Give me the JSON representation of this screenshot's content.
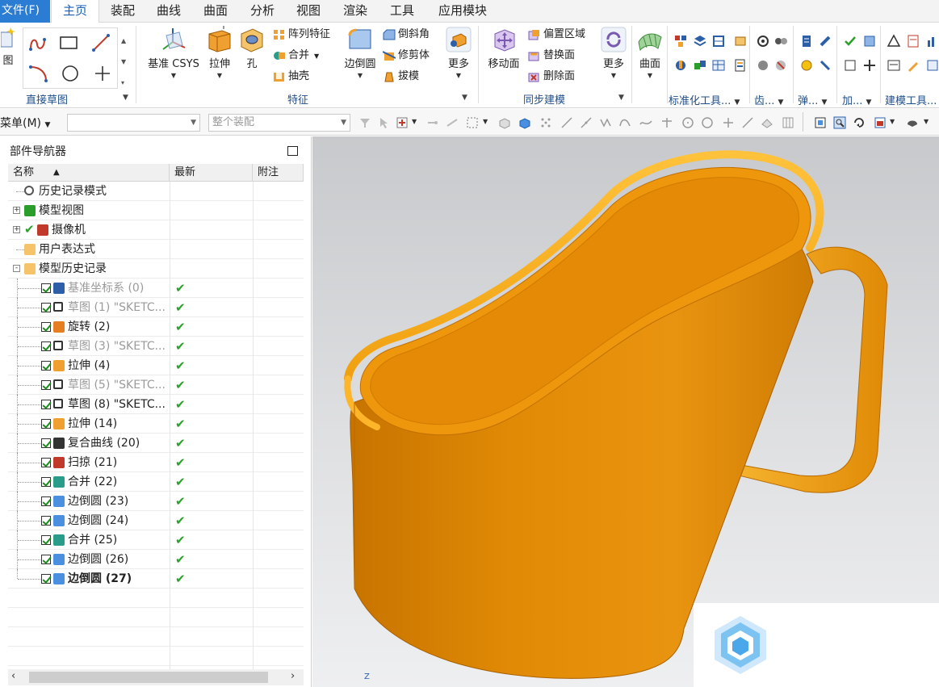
{
  "menubar": {
    "file": "文件(F)",
    "tabs": [
      "主页",
      "装配",
      "曲线",
      "曲面",
      "分析",
      "视图",
      "渲染",
      "工具",
      "应用模块"
    ],
    "active_tab": "主页"
  },
  "ribbon": {
    "sketch_group": {
      "first_label": "图",
      "label": "直接草图"
    },
    "feature_group": {
      "label": "特征",
      "datum_csys": "基准 CSYS",
      "extrude": "拉伸",
      "hole": "孔",
      "pattern": "阵列特征",
      "unite": "合并",
      "shell": "抽壳",
      "edge_blend": "边倒圆",
      "chamfer": "倒斜角",
      "trim": "修剪体",
      "draft": "拔模",
      "more": "更多"
    },
    "sync_group": {
      "label": "同步建模",
      "move_face": "移动面",
      "offset_region": "偏置区域",
      "replace_face": "替换面",
      "delete_face": "删除面",
      "more": "更多"
    },
    "surface": "曲面",
    "small_groups": [
      "标准化工具...",
      "齿...",
      "弹...",
      "加...",
      "建模工具..."
    ]
  },
  "toolbar2": {
    "menu": "菜单(M)",
    "filter_value": "",
    "scope": "整个装配"
  },
  "navigator": {
    "title": "部件导航器",
    "columns": [
      "名称",
      "最新",
      "附注"
    ],
    "items": [
      {
        "label": "历史记录模式",
        "icon": "clock-icon",
        "level": 0,
        "expander": "",
        "check": false,
        "current": ""
      },
      {
        "label": "模型视图",
        "icon": "model-views-icon",
        "level": 0,
        "expander": "+",
        "check": false,
        "current": ""
      },
      {
        "label": "摄像机",
        "icon": "camera-icon",
        "level": 0,
        "expander": "+",
        "check": false,
        "current": ""
      },
      {
        "label": "用户表达式",
        "icon": "folder-icon",
        "level": 0,
        "expander": "",
        "check": false,
        "current": ""
      },
      {
        "label": "模型历史记录",
        "icon": "folder-open-icon",
        "level": 0,
        "expander": "-",
        "check": false,
        "current": ""
      },
      {
        "label": "基准坐标系 (0)",
        "icon": "datum-csys-icon",
        "level": 1,
        "check": true,
        "current": "✔",
        "gray": true
      },
      {
        "label": "草图 (1) \"SKETC...",
        "icon": "sketch-icon",
        "level": 1,
        "check": true,
        "current": "✔",
        "gray": true
      },
      {
        "label": "旋转 (2)",
        "icon": "revolve-icon",
        "level": 1,
        "check": true,
        "current": "✔"
      },
      {
        "label": "草图 (3) \"SKETC...",
        "icon": "sketch-icon",
        "level": 1,
        "check": true,
        "current": "✔",
        "gray": true
      },
      {
        "label": "拉伸 (4)",
        "icon": "extrude-icon",
        "level": 1,
        "check": true,
        "current": "✔"
      },
      {
        "label": "草图 (5) \"SKETC...",
        "icon": "sketch-icon",
        "level": 1,
        "check": true,
        "current": "✔",
        "gray": true
      },
      {
        "label": "草图 (8) \"SKETC...",
        "icon": "sketch-icon",
        "level": 1,
        "check": true,
        "current": "✔"
      },
      {
        "label": "拉伸 (14)",
        "icon": "extrude-icon",
        "level": 1,
        "check": true,
        "current": "✔"
      },
      {
        "label": "复合曲线 (20)",
        "icon": "composite-curve-icon",
        "level": 1,
        "check": true,
        "current": "✔"
      },
      {
        "label": "扫掠 (21)",
        "icon": "swept-icon",
        "level": 1,
        "check": true,
        "current": "✔"
      },
      {
        "label": "合并 (22)",
        "icon": "unite-icon",
        "level": 1,
        "check": true,
        "current": "✔"
      },
      {
        "label": "边倒圆 (23)",
        "icon": "edge-blend-icon",
        "level": 1,
        "check": true,
        "current": "✔"
      },
      {
        "label": "边倒圆 (24)",
        "icon": "edge-blend-icon",
        "level": 1,
        "check": true,
        "current": "✔"
      },
      {
        "label": "合并 (25)",
        "icon": "unite-icon",
        "level": 1,
        "check": true,
        "current": "✔"
      },
      {
        "label": "边倒圆 (26)",
        "icon": "edge-blend-icon",
        "level": 1,
        "check": true,
        "current": "✔"
      },
      {
        "label": "边倒圆 (27)",
        "icon": "edge-blend-icon",
        "level": 1,
        "check": true,
        "current": "✔",
        "bold": true
      }
    ]
  },
  "viewport": {
    "axis_label": "Z",
    "model_color": "#e8900a"
  },
  "colors": {
    "accent": "#2b7cd3",
    "group_label": "#1f4f8a",
    "check_green": "#2aa12a"
  }
}
